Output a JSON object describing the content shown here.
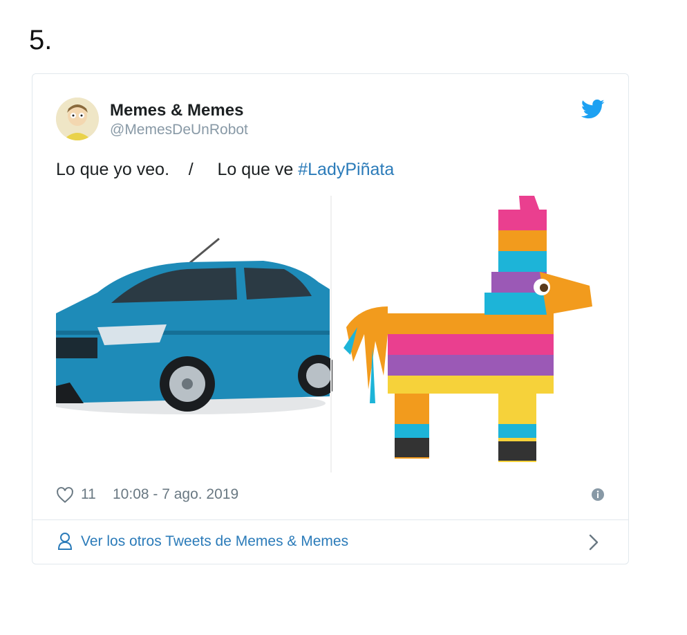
{
  "list_number": "5.",
  "tweet": {
    "display_name": "Memes & Memes",
    "handle": "@MemesDeUnRobot",
    "text_plain": "Lo que yo veo.    /     Lo que ve ",
    "hashtag": "#LadyPiñata",
    "likes": "11",
    "timestamp": "10:08 - 7 ago. 2019",
    "more_tweets_label": "Ver los otros Tweets de Memes & Memes"
  },
  "icons": {
    "brand": "twitter-bird-icon",
    "like": "heart-icon",
    "info": "info-icon",
    "profile": "person-icon",
    "next": "chevron-right-icon"
  },
  "colors": {
    "link": "#2b7bb9",
    "twitter_blue": "#1da1f2",
    "muted": "#697882",
    "border": "#e1e8ed"
  }
}
